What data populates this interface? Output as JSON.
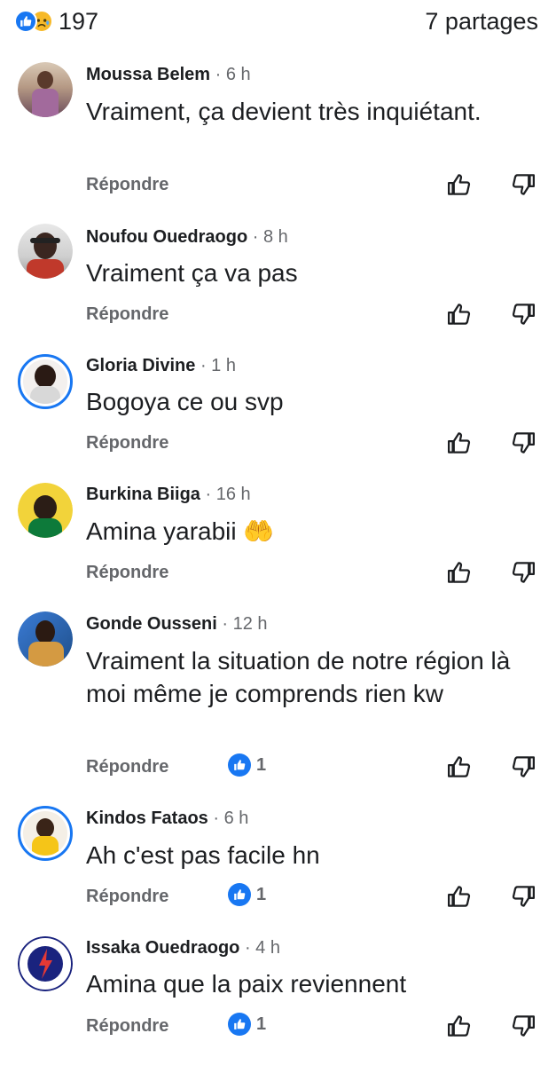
{
  "header": {
    "reaction_count": "197",
    "shares": "7 partages",
    "reaction_icons": [
      "like-icon",
      "sad-icon"
    ]
  },
  "colors": {
    "accent": "#1877f2",
    "secondary_text": "#65676b",
    "primary_text": "#1c1e21"
  },
  "comments": [
    {
      "name": "Moussa Belem",
      "time": "· 6 h",
      "text": "Vraiment, ça devient très inquiétant.",
      "reply": "Répondre",
      "likes": ""
    },
    {
      "name": "Noufou Ouedraogo",
      "time": "· 8 h",
      "text": "Vraiment ça va pas",
      "reply": "Répondre",
      "likes": ""
    },
    {
      "name": "Gloria Divine",
      "time": "· 1 h",
      "text": "Bogoya ce ou svp",
      "reply": "Répondre",
      "likes": ""
    },
    {
      "name": "Burkina Biiga",
      "time": "· 16 h",
      "text": "Amina yarabii 🤲",
      "reply": "Répondre",
      "likes": ""
    },
    {
      "name": "Gonde Ousseni",
      "time": "· 12 h",
      "text": "Vraiment la situation de notre région là moi même je comprends rien kw",
      "reply": "Répondre",
      "likes": "1"
    },
    {
      "name": "Kindos Fataos",
      "time": "· 6 h",
      "text": "Ah c'est pas facile hn",
      "reply": "Répondre",
      "likes": "1"
    },
    {
      "name": "Issaka Ouedraogo",
      "time": "· 4 h",
      "text": "Amina que la paix reviennent",
      "reply": "Répondre",
      "likes": "1"
    }
  ]
}
